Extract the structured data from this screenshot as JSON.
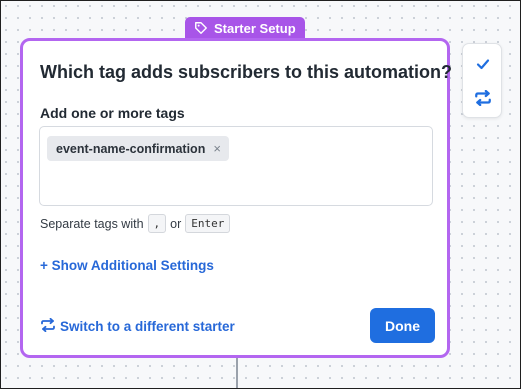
{
  "badge": {
    "label": "Starter Setup",
    "icon": "tag-icon"
  },
  "dialog": {
    "title": "Which tag adds subscribers to this automation?",
    "field_label": "Add one or more tags",
    "tags": [
      {
        "label": "event-name-confirmation",
        "remove": "×"
      }
    ],
    "helper": {
      "prefix": "Separate tags with",
      "key_comma": ",",
      "or": "or",
      "key_enter": "Enter"
    },
    "show_more": "+ Show Additional Settings",
    "switch_label": "Switch to a different starter",
    "done_label": "Done"
  },
  "side_panel": {
    "icons": [
      "check-icon",
      "swap-icon"
    ]
  },
  "colors": {
    "accent": "#b366f0",
    "badge": "#a855e8",
    "link": "#2768d8",
    "primary": "#1f6ee0"
  }
}
